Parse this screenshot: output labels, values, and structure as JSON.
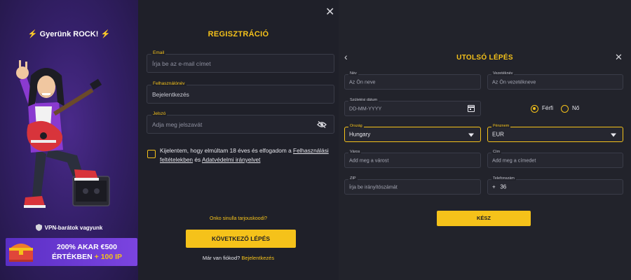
{
  "promo": {
    "title": "Gyerünk ROCK!",
    "vpn_text": "VPN-barátok vagyunk",
    "banner_line1": "200% AKAR €500",
    "banner_line2_a": "ÉRTÉKBEN ",
    "banner_line2_b": "+ 100 IP"
  },
  "registration": {
    "title": "REGISZTRÁCIÓ",
    "email": {
      "label": "Email",
      "placeholder": "Írja be az e-mail címet"
    },
    "username": {
      "label": "Felhasználónév",
      "value": "Bejelentkezés"
    },
    "password": {
      "label": "Jelszó",
      "placeholder": "Adja meg jelszavát"
    },
    "terms": {
      "prefix": "Kijelentem, hogy elmúltam 18 éves és elfogadom a ",
      "link1": "Felhasználási feltételekben",
      "middle": " és ",
      "link2": "Adatvédelmi irányelvet"
    },
    "promo_code_question": "Onko sinulla tarjouskoodi?",
    "next_button": "KÖVETKEZŐ LÉPÉS",
    "have_account": "Már van fiókod? ",
    "login_link": "Bejelentkezés"
  },
  "final_step": {
    "title": "UTOLSÓ LÉPÉS",
    "first_name": {
      "label": "Név",
      "placeholder": "Az Ön neve"
    },
    "last_name": {
      "label": "Vezetéknév",
      "placeholder": "Az Ön vezetékneve"
    },
    "birth_date": {
      "label": "Születési dátum",
      "placeholder": "DD-MM-YYYY"
    },
    "gender": {
      "male": "Férfi",
      "female": "Nő",
      "selected": "male"
    },
    "country": {
      "label": "Ország",
      "value": "Hungary"
    },
    "currency": {
      "label": "Pénznem",
      "value": "EUR"
    },
    "city": {
      "label": "Város",
      "placeholder": "Add meg a várost"
    },
    "address": {
      "label": "Cím",
      "placeholder": "Add meg a címedet"
    },
    "zip": {
      "label": "ZIP",
      "placeholder": "Írja be irányítószámát"
    },
    "phone": {
      "label": "Telefonszám",
      "prefix": "+",
      "code": "36"
    },
    "submit_button": "KÉSZ"
  },
  "colors": {
    "accent": "#f5c21a",
    "background": "#1f2029",
    "promo_purple": "#35206a",
    "banner_purple": "#6a3ad4"
  },
  "icons": [
    "lightning-icon",
    "shield-icon",
    "close-icon",
    "eye-off-icon",
    "back-arrow-icon",
    "calendar-icon",
    "dropdown-arrow-icon",
    "treasure-chest-icon"
  ]
}
